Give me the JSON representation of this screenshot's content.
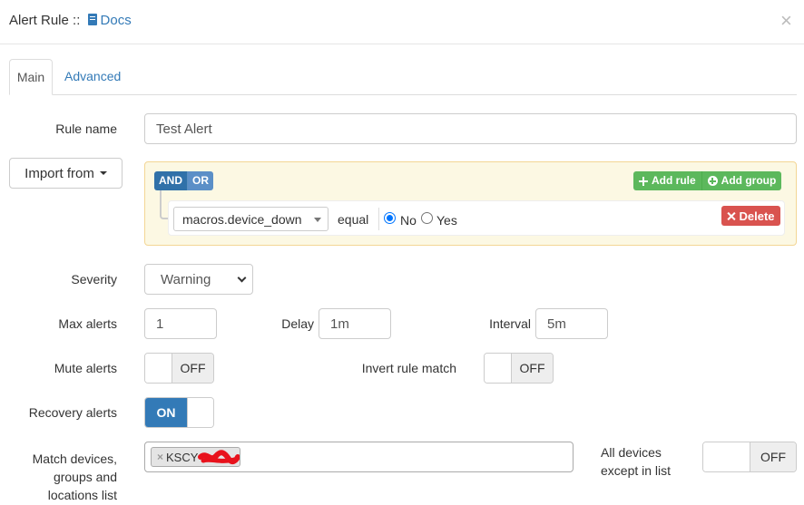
{
  "modal": {
    "title": "Alert Rule ::",
    "docs_label": "Docs",
    "close_glyph": "×"
  },
  "tabs": [
    {
      "label": "Main",
      "active": true
    },
    {
      "label": "Advanced",
      "active": false
    }
  ],
  "form": {
    "rule_name_label": "Rule name",
    "rule_name_value": "Test Alert",
    "import_label": "Import from",
    "query_builder": {
      "and_label": "AND",
      "or_label": "OR",
      "add_rule_label": "Add rule",
      "add_group_label": "Add group",
      "rule": {
        "field": "macros.device_down",
        "operator": "equal",
        "option_no": "No",
        "option_yes": "Yes",
        "selected": "No"
      },
      "delete_label": "Delete"
    },
    "severity_label": "Severity",
    "severity_value": "Warning",
    "max_alerts_label": "Max alerts",
    "max_alerts_value": "1",
    "delay_label": "Delay",
    "delay_value": "1m",
    "interval_label": "Interval",
    "interval_value": "5m",
    "mute_alerts_label": "Mute alerts",
    "mute_alerts_state": "OFF",
    "invert_label": "Invert rule match",
    "invert_state": "OFF",
    "recovery_label": "Recovery alerts",
    "recovery_state": "ON",
    "match_label_line1": "Match devices,",
    "match_label_line2": "groups and",
    "match_label_line3": "locations list",
    "match_tag_remove": "×",
    "match_tag_text": "KSCY",
    "all_devices_line1": "All devices",
    "all_devices_line2": "except in list",
    "all_devices_state": "OFF"
  },
  "colors": {
    "link": "#337ab7",
    "success": "#5cb85c",
    "danger": "#d9534f",
    "qb_background": "#fcf8e3",
    "qb_border": "#f3d695",
    "redaction": "#e8121c"
  },
  "icons": {
    "docs": "book-icon",
    "close": "close-icon",
    "add_rule": "plus-icon",
    "add_group": "plus-circle-icon",
    "delete": "x-icon",
    "select": "chevron-down-icon"
  }
}
